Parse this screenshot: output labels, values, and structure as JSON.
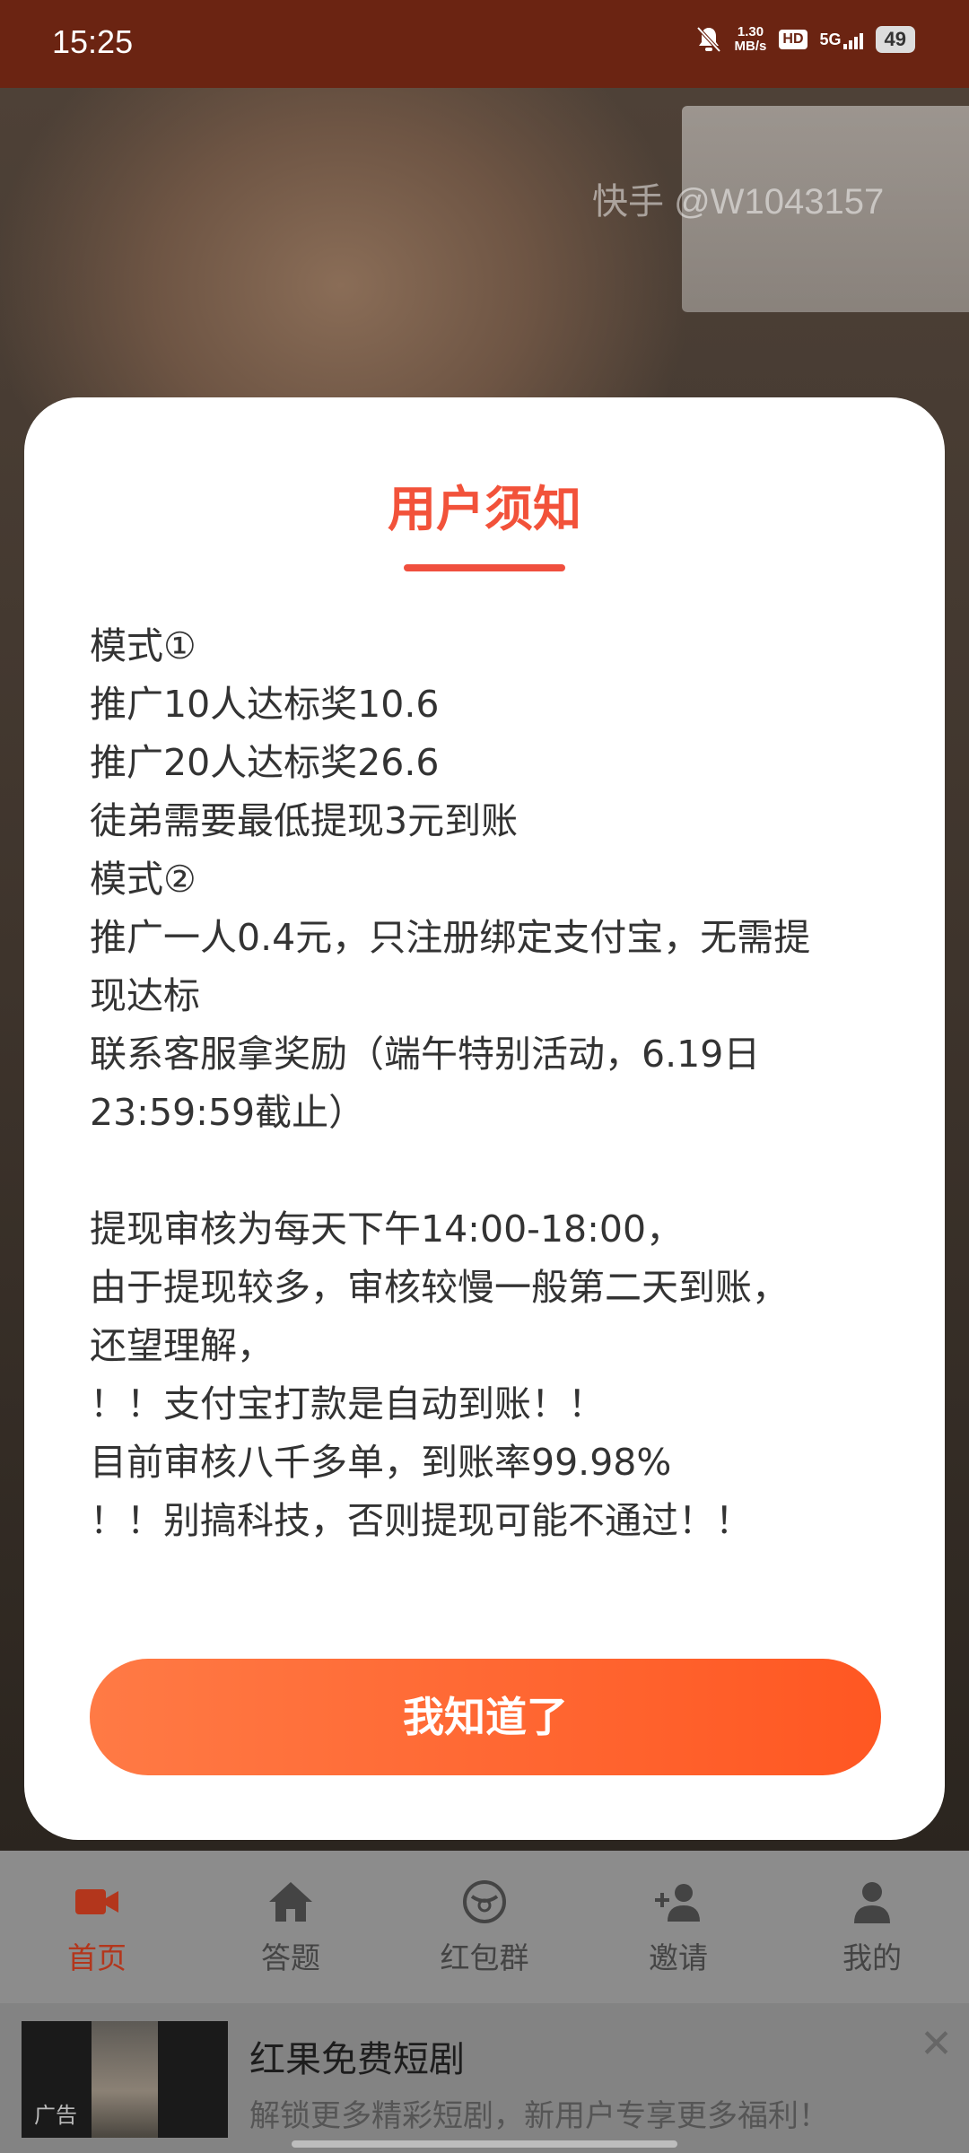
{
  "status_bar": {
    "time": "15:25",
    "net_speed_value": "1.30",
    "net_speed_unit": "MB/s",
    "hd": "HD",
    "network": "5G",
    "battery": "49"
  },
  "video": {
    "watermark": "快手 @W1043157"
  },
  "modal": {
    "title": "用户须知",
    "lines": [
      "模式①",
      "推广10人达标奖10.6",
      "推广20人达标奖26.6",
      "徒弟需要最低提现3元到账",
      "模式②",
      "推广一人0.4元，只注册绑定支付宝，无需提",
      "现达标",
      "联系客服拿奖励（端午特别活动，6.19日",
      "23:59:59截止）",
      "",
      "提现审核为每天下午14:00-18:00，",
      "由于提现较多，审核较慢一般第二天到账，",
      "还望理解，",
      "！！支付宝打款是自动到账！！",
      "目前审核八千多单，到账率99.98%",
      "！！别搞科技，否则提现可能不通过！！"
    ],
    "confirm_label": "我知道了",
    "accent_color": "#f2523a"
  },
  "tabbar": {
    "items": [
      {
        "label": "首页",
        "icon": "video-camera-icon",
        "active": true
      },
      {
        "label": "答题",
        "icon": "home-icon",
        "active": false
      },
      {
        "label": "红包群",
        "icon": "red-envelope-icon",
        "active": false
      },
      {
        "label": "邀请",
        "icon": "add-user-icon",
        "active": false
      },
      {
        "label": "我的",
        "icon": "user-icon",
        "active": false
      }
    ]
  },
  "ad": {
    "tag": "广告",
    "title": "红果免费短剧",
    "description": "解锁更多精彩短剧，新用户专享更多福利！"
  }
}
